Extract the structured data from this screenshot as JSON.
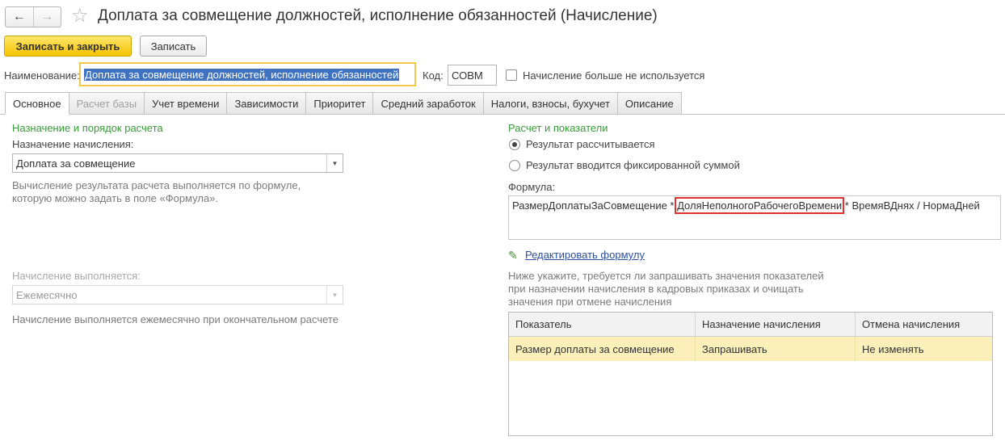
{
  "window": {
    "title": "Доплата за совмещение должностей, исполнение обязанностей (Начисление)"
  },
  "nav": {
    "back_icon": "←",
    "forward_icon": "→",
    "star_icon": "☆"
  },
  "toolbar": {
    "save_close_label": "Записать и закрыть",
    "save_label": "Записать"
  },
  "header_fields": {
    "name_label": "Наименование:",
    "name_value": "Доплата за совмещение должностей, исполнение обязанностей",
    "code_label": "Код:",
    "code_value": "СОВМ",
    "unused_label": "Начисление больше не используется",
    "unused_checked": false
  },
  "tabs": [
    {
      "label": "Основное",
      "active": true,
      "disabled": false
    },
    {
      "label": "Расчет базы",
      "active": false,
      "disabled": true
    },
    {
      "label": "Учет времени",
      "active": false,
      "disabled": false
    },
    {
      "label": "Зависимости",
      "active": false,
      "disabled": false
    },
    {
      "label": "Приоритет",
      "active": false,
      "disabled": false
    },
    {
      "label": "Средний заработок",
      "active": false,
      "disabled": false
    },
    {
      "label": "Налоги, взносы, бухучет",
      "active": false,
      "disabled": false
    },
    {
      "label": "Описание",
      "active": false,
      "disabled": false
    }
  ],
  "left": {
    "section_title": "Назначение и порядок расчета",
    "purpose_label": "Назначение начисления:",
    "purpose_value": "Доплата за совмещение",
    "purpose_hint_line1": "Вычисление результата расчета выполняется по формуле,",
    "purpose_hint_line2": "которую можно задать в поле «Формула».",
    "periodicity_label": "Начисление выполняется:",
    "periodicity_value": "Ежемесячно",
    "periodicity_hint": "Начисление выполняется ежемесячно при окончательном расчете"
  },
  "right": {
    "section_title": "Расчет и показатели",
    "radio_calculated": "Результат рассчитывается",
    "radio_fixed": "Результат вводится фиксированной суммой",
    "selected_radio": "calculated",
    "formula_label": "Формула:",
    "formula_part1": "РазмерДоплатыЗаСовмещение * ",
    "formula_highlight": "ДоляНеполногоРабочегоВремени",
    "formula_part2": " * ВремяВДнях / НормаДней",
    "edit_formula_link": "Редактировать формулу",
    "indicators_hint_line1": "Ниже укажите, требуется ли запрашивать значения показателей",
    "indicators_hint_line2": "при назначении начисления в кадровых приказах и очищать",
    "indicators_hint_line3": "значения при отмене начисления",
    "table": {
      "columns": [
        "Показатель",
        "Назначение начисления",
        "Отмена начисления"
      ],
      "rows": [
        [
          "Размер доплаты за совмещение",
          "Запрашивать",
          "Не изменять"
        ]
      ]
    }
  }
}
